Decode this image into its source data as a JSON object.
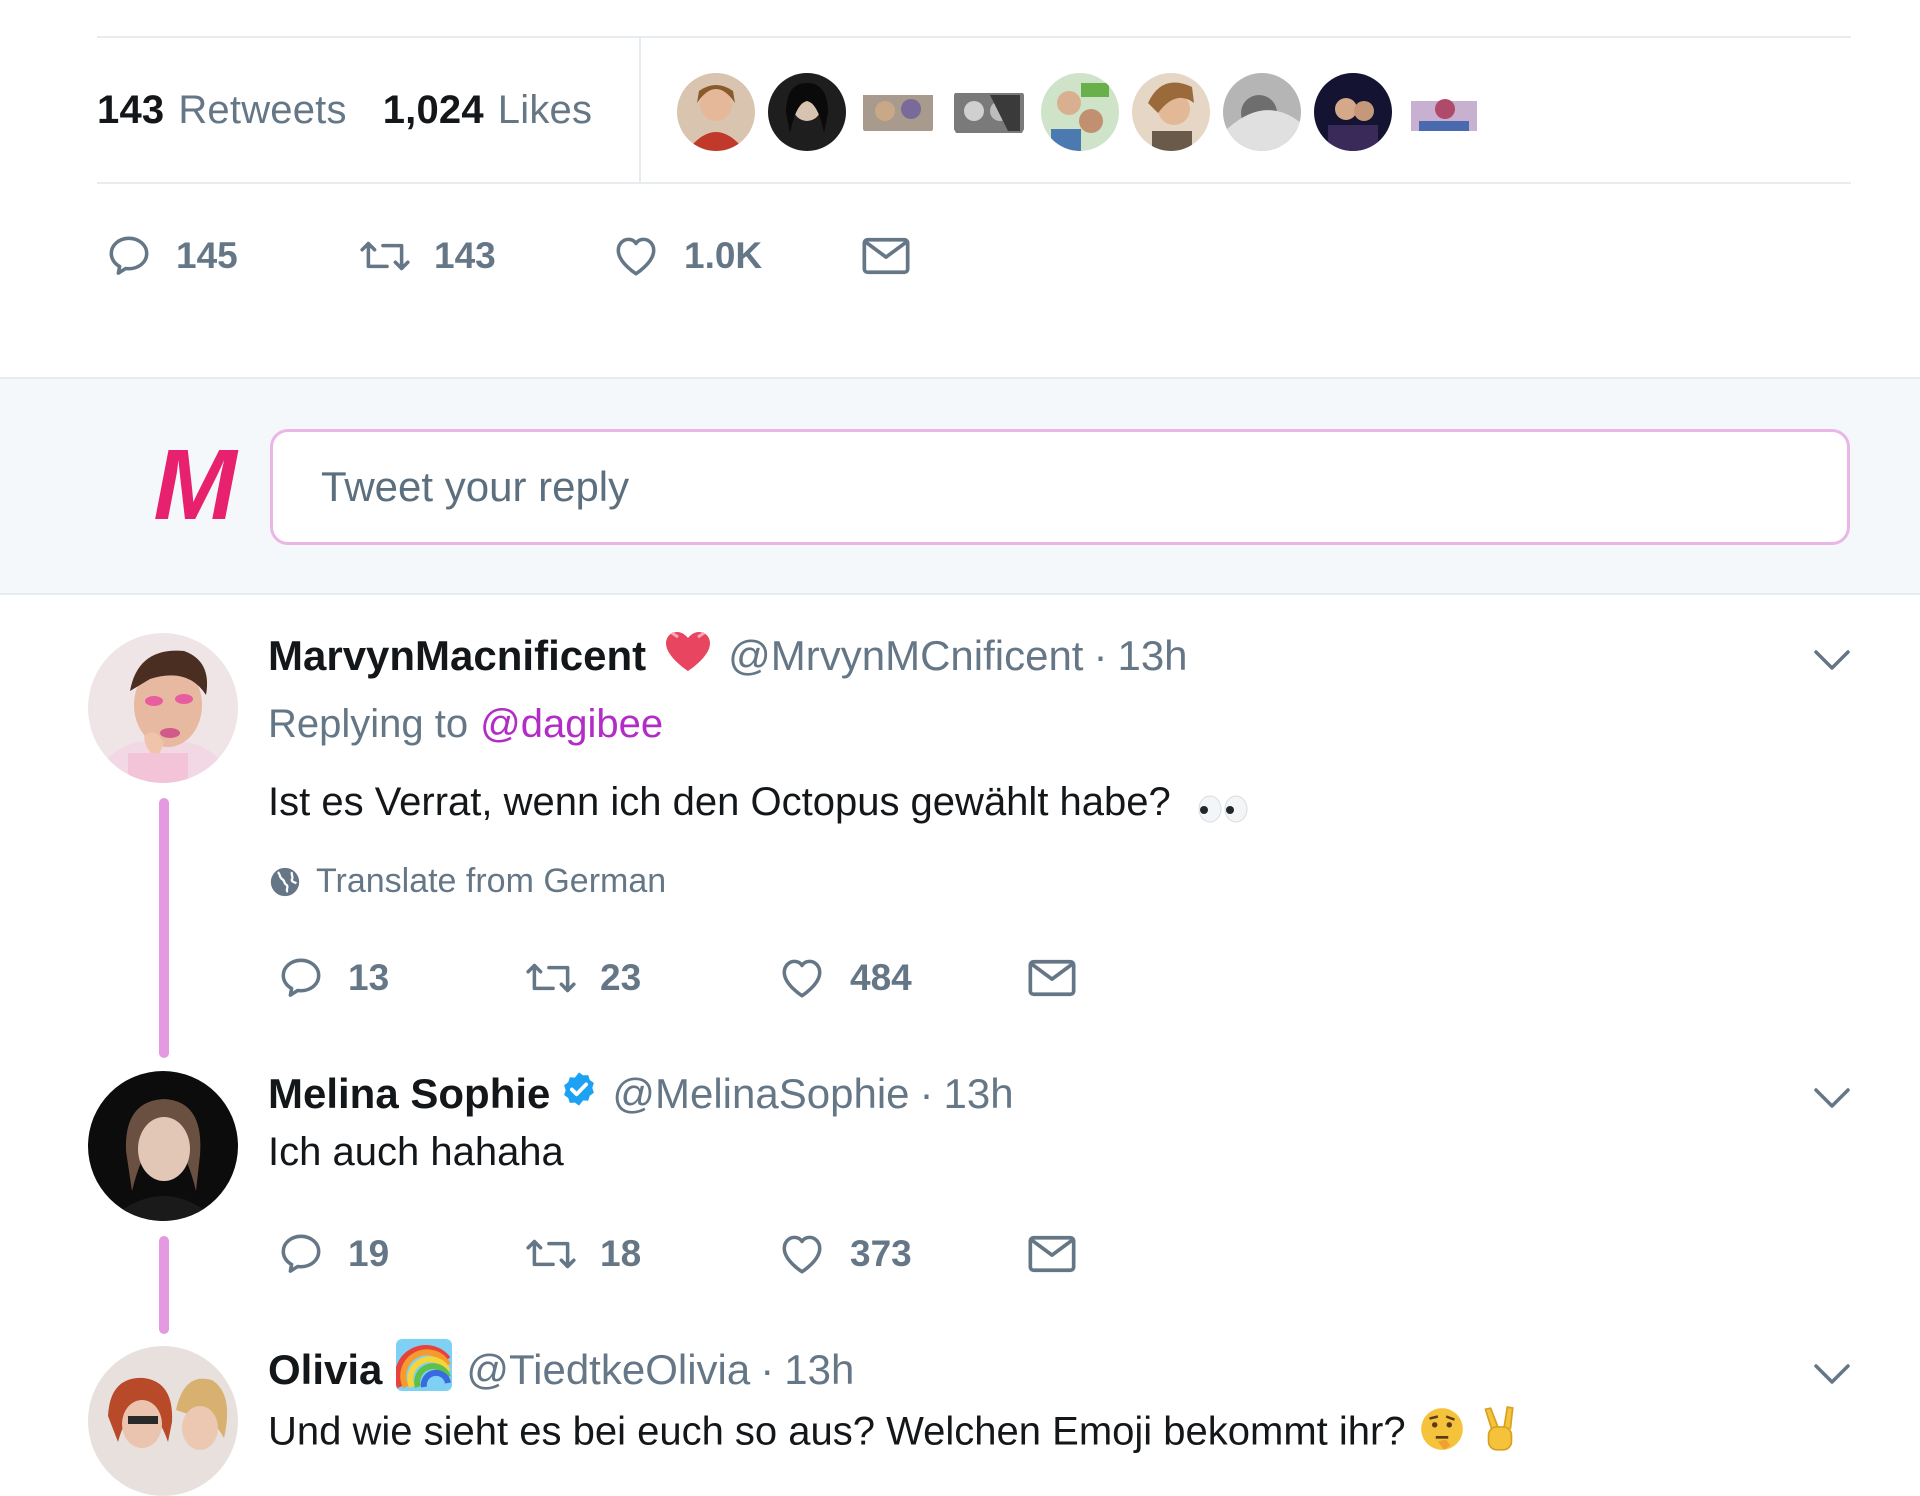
{
  "stats": {
    "retweets_count": "143",
    "retweets_label": "Retweets",
    "likes_count": "1,024",
    "likes_label": "Likes",
    "likers": [
      "#c85a4a",
      "#2b2b2b",
      "#8a7a6a",
      "#5a5a5a",
      "#6a9a5a",
      "#b08a6a",
      "#9a9a9a",
      "#1a1a3a",
      "#b0a0c0"
    ]
  },
  "main_actions": {
    "replies": "145",
    "retweets": "143",
    "likes": "1.0K"
  },
  "composer": {
    "logo_letter": "M",
    "logo_color": "#e8216e",
    "placeholder": "Tweet your reply"
  },
  "tweets": [
    {
      "name": "MarvynMacnificent",
      "name_emoji": "heart",
      "handle": "@MrvynMCnificent",
      "separator": "·",
      "time": "13h",
      "replying_prefix": "Replying to",
      "replying_to": "@dagibee",
      "text": "Ist es Verrat, wenn ich den Octopus gewählt habe?",
      "text_emoji": "eyes",
      "translate": "Translate from German",
      "replies": "13",
      "retweets": "23",
      "likes": "484"
    },
    {
      "name": "Melina Sophie",
      "verified": true,
      "handle": "@MelinaSophie",
      "separator": "·",
      "time": "13h",
      "text": "Ich auch hahaha",
      "replies": "19",
      "retweets": "18",
      "likes": "373"
    },
    {
      "name": "Olivia",
      "name_emoji": "rainbow",
      "handle": "@TiedtkeOlivia",
      "separator": "·",
      "time": "13h",
      "text": "Und wie sieht es bei euch so aus? Welchen Emoji bekommt ihr?",
      "text_emoji": "thinking, victory-hand"
    }
  ],
  "colors": {
    "thread_line": "#e39ae0",
    "mention": "#b22cc6",
    "verified": "#1da1f2",
    "icon_gray": "#657786"
  }
}
